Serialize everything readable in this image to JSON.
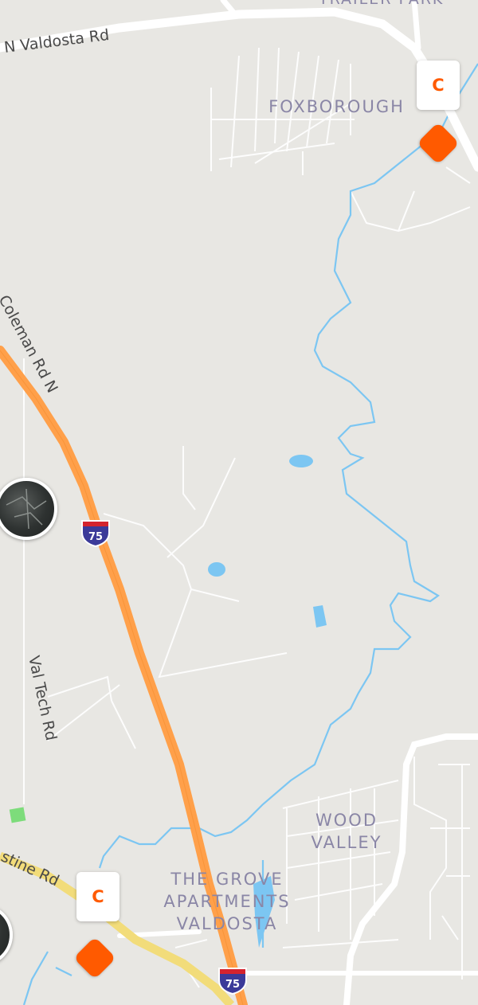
{
  "map": {
    "roads": [
      {
        "id": "n-valdosta-rd",
        "label": "N Valdosta Rd"
      },
      {
        "id": "coleman-rd-n",
        "label": "Coleman Rd N"
      },
      {
        "id": "val-tech-rd",
        "label": "Val Tech Rd"
      },
      {
        "id": "stine-rd",
        "label": "stine Rd"
      }
    ],
    "partial_top_label": "TRAILER PARK",
    "areas": [
      {
        "id": "foxborough",
        "label": "FOXBOROUGH"
      },
      {
        "id": "wood-valley",
        "label": "WOOD\nVALLEY"
      },
      {
        "id": "the-grove",
        "label": "THE GROVE\nAPARTMENTS\nVALDOSTA"
      }
    ],
    "highway_shields": [
      {
        "id": "i75-north",
        "number": "75"
      },
      {
        "id": "i75-south",
        "number": "75"
      }
    ],
    "category_badges": [
      {
        "id": "badge-top",
        "letter": "C"
      },
      {
        "id": "badge-bottom",
        "letter": "C"
      }
    ],
    "colors": {
      "land": "#e8e7e3",
      "highway": "#ffa04a",
      "secondary_road": "#f2dc7a",
      "water": "#7cc6f2",
      "marker": "#ff5a00",
      "area_label": "#8a86a6",
      "shield_red": "#d4232e",
      "shield_blue": "#3b3a99"
    }
  }
}
